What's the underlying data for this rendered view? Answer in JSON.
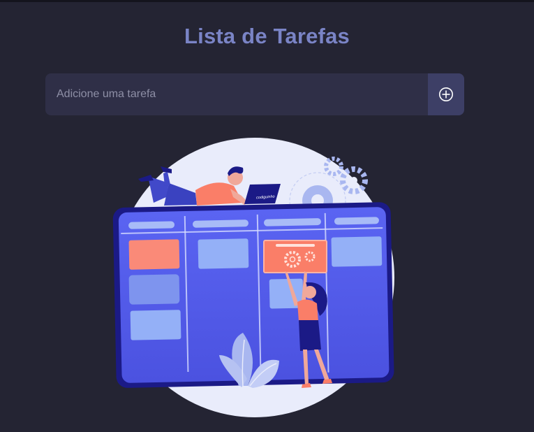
{
  "app": {
    "title": "Lista de Tarefas"
  },
  "task_form": {
    "placeholder": "Adicione uma tarefa",
    "value": "",
    "add_icon": "plus-circle-icon"
  },
  "illustration": {
    "subject": "kanban-board-with-two-people",
    "laptop_label": "codiguinho"
  },
  "colors": {
    "background": "#242433",
    "title": "#7a84c6",
    "input_bg": "#2f2f47",
    "button_bg": "#3d3f66",
    "board": "#5660ef",
    "accent": "#fa7e68"
  }
}
